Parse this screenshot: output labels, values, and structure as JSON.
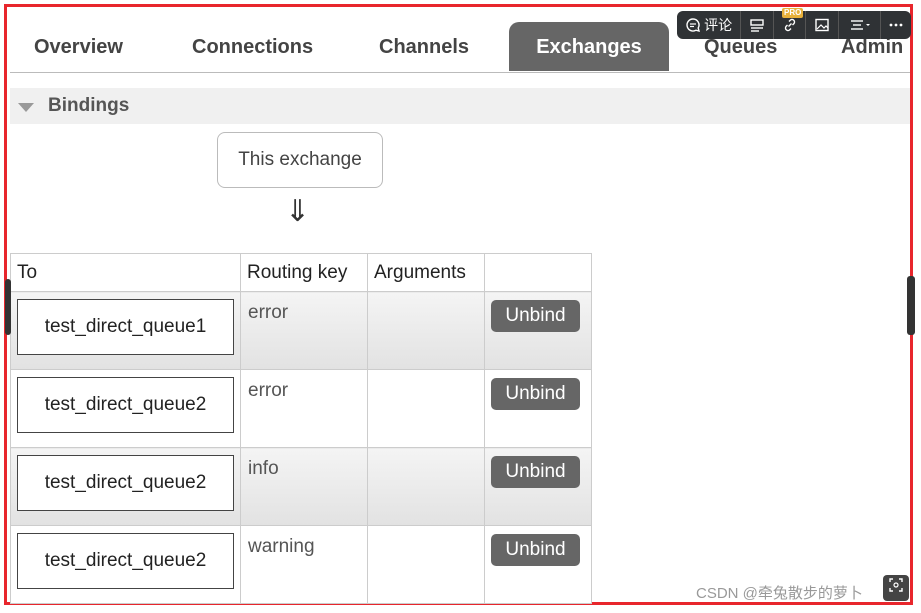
{
  "tabs": {
    "overview": "Overview",
    "connections": "Connections",
    "channels": "Channels",
    "exchanges": "Exchanges",
    "queues": "Queues",
    "admin": "Admin"
  },
  "toolbar": {
    "comment": "评论",
    "pro_badge": "PRO"
  },
  "bindings": {
    "title": "Bindings",
    "this_exchange": "This exchange",
    "arrow": "⇓",
    "columns": [
      "To",
      "Routing key",
      "Arguments",
      ""
    ],
    "rows": [
      {
        "to": "test_direct_queue1",
        "routing_key": "error",
        "arguments": "",
        "action": "Unbind"
      },
      {
        "to": "test_direct_queue2",
        "routing_key": "error",
        "arguments": "",
        "action": "Unbind"
      },
      {
        "to": "test_direct_queue2",
        "routing_key": "info",
        "arguments": "",
        "action": "Unbind"
      },
      {
        "to": "test_direct_queue2",
        "routing_key": "warning",
        "arguments": "",
        "action": "Unbind"
      }
    ]
  },
  "watermark": "CSDN @牵兔散步的萝卜",
  "colors": {
    "frame": "#e8262c",
    "active_tab": "#666666",
    "button": "#666666"
  }
}
